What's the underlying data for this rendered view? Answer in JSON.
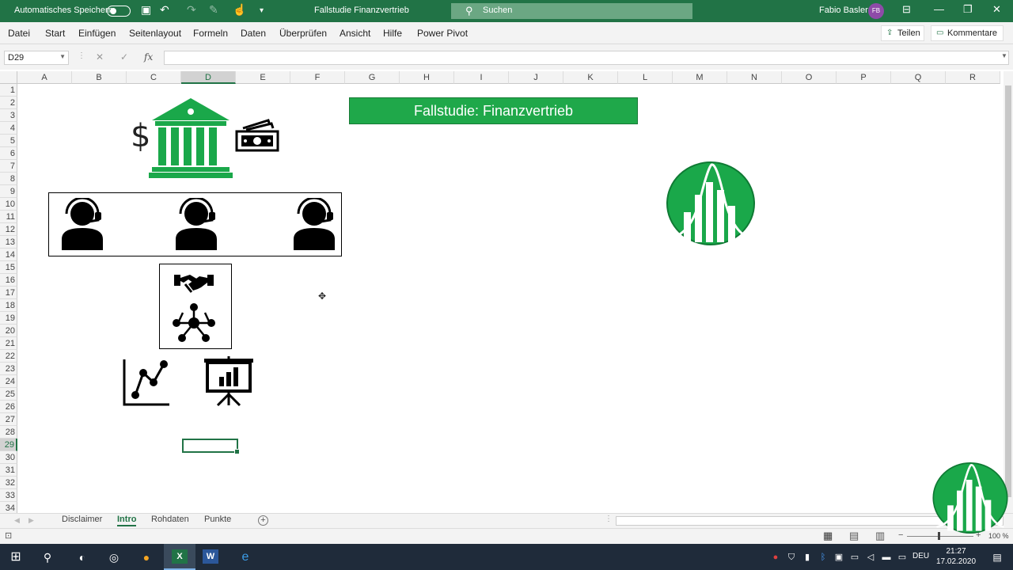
{
  "titlebar": {
    "autosave_label": "Automatisches Speichern",
    "document_title": "Fallstudie Finanzvertrieb",
    "search_placeholder": "Suchen",
    "user_name": "Fabio Basler",
    "user_initials": "FB"
  },
  "menu": {
    "items": [
      "Datei",
      "Start",
      "Einfügen",
      "Seitenlayout",
      "Formeln",
      "Daten",
      "Überprüfen",
      "Ansicht",
      "Hilfe",
      "Power Pivot"
    ],
    "share_label": "Teilen",
    "comments_label": "Kommentare"
  },
  "formula_bar": {
    "name_box": "D29",
    "fx_label": "fx",
    "formula": ""
  },
  "grid": {
    "columns": [
      "A",
      "B",
      "C",
      "D",
      "E",
      "F",
      "G",
      "H",
      "I",
      "J",
      "K",
      "L",
      "M",
      "N",
      "O",
      "P",
      "Q",
      "R"
    ],
    "rows": [
      "1",
      "2",
      "3",
      "4",
      "5",
      "6",
      "7",
      "8",
      "9",
      "10",
      "11",
      "12",
      "13",
      "14",
      "15",
      "16",
      "17",
      "18",
      "19",
      "20",
      "21",
      "22",
      "23",
      "24",
      "25",
      "26",
      "27",
      "28",
      "29",
      "30",
      "31",
      "32",
      "33",
      "34"
    ],
    "active_column": "D",
    "active_row": "29"
  },
  "sheet": {
    "banner_text": "Fallstudie: Finanzvertrieb",
    "dollar_symbol": "$"
  },
  "sheet_tabs": {
    "tabs": [
      "Disclaimer",
      "Intro",
      "Rohdaten",
      "Punkte"
    ],
    "active_tab": "Intro"
  },
  "status": {
    "zoom": "100 %"
  },
  "taskbar": {
    "language": "DEU",
    "time": "21:27",
    "date": "17.02.2020"
  },
  "colors": {
    "excel_green": "#217346",
    "banner_green": "#1fa84a",
    "icon_green": "#1aa84a"
  }
}
